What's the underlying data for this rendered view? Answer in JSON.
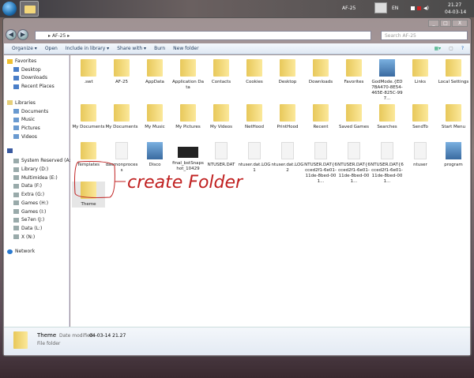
{
  "taskbar": {
    "user": "AF-25",
    "lang": "EN",
    "time": "21.27",
    "date": "04-03-14"
  },
  "window": {
    "caption_buttons": [
      "_",
      "□",
      "X"
    ]
  },
  "address": {
    "path": "AF-25",
    "separator": "▸",
    "search_placeholder": "Search AF-25"
  },
  "toolbar": {
    "items": [
      "Organize ▾",
      "Open",
      "Include in library ▾",
      "Share with ▾",
      "Burn",
      "New folder"
    ]
  },
  "sidebar": {
    "favorites": {
      "label": "Favorites",
      "items": [
        "Desktop",
        "Downloads",
        "Recent Places"
      ]
    },
    "libraries": {
      "label": "Libraries",
      "items": [
        "Documents",
        "Music",
        "Pictures",
        "Videos"
      ]
    },
    "computer": {
      "items": [
        "System Reserved (A:",
        "Library (D:)",
        "Multimidea (E:)",
        "Data (F:)",
        "Extra (G:)",
        "Games (H:)",
        "Games (I:)",
        "Se7en (J:)",
        "Data (L:)",
        "X (N:)"
      ]
    },
    "network": "Network"
  },
  "files": [
    {
      "name": ".swt",
      "type": "folder"
    },
    {
      "name": "AF-25",
      "type": "folder"
    },
    {
      "name": "AppData",
      "type": "folder"
    },
    {
      "name": "Application Data",
      "type": "folder"
    },
    {
      "name": "Contacts",
      "type": "folder"
    },
    {
      "name": "Cookies",
      "type": "folder"
    },
    {
      "name": "Desktop",
      "type": "folder"
    },
    {
      "name": "Downloads",
      "type": "folder"
    },
    {
      "name": "Favorites",
      "type": "folder"
    },
    {
      "name": "GodMode.{ED7BA470-8E54-465E-825C-997...",
      "type": "app"
    },
    {
      "name": "Links",
      "type": "folder"
    },
    {
      "name": "Local Settings",
      "type": "folder"
    },
    {
      "name": "My Documents",
      "type": "folder"
    },
    {
      "name": "My Documents",
      "type": "folder"
    },
    {
      "name": "My Music",
      "type": "folder"
    },
    {
      "name": "My Pictures",
      "type": "folder"
    },
    {
      "name": "My Videos",
      "type": "folder"
    },
    {
      "name": "NetHood",
      "type": "folder"
    },
    {
      "name": "PrintHood",
      "type": "folder"
    },
    {
      "name": "Recent",
      "type": "folder"
    },
    {
      "name": "Saved Games",
      "type": "folder"
    },
    {
      "name": "Searches",
      "type": "folder"
    },
    {
      "name": "SendTo",
      "type": "folder"
    },
    {
      "name": "Start Menu",
      "type": "folder"
    },
    {
      "name": "Templates",
      "type": "folder"
    },
    {
      "name": "daemonprocess",
      "type": "file"
    },
    {
      "name": "Disco",
      "type": "app"
    },
    {
      "name": "final_bstSnapshot_10429",
      "type": "image"
    },
    {
      "name": "NTUSER.DAT",
      "type": "file"
    },
    {
      "name": "ntuser.dat.LOG1",
      "type": "file"
    },
    {
      "name": "ntuser.dat.LOG2",
      "type": "file"
    },
    {
      "name": "NTUSER.DAT{6cced2f1-6e01-11de-8bed-001...",
      "type": "file"
    },
    {
      "name": "NTUSER.DAT{6cced2f1-6e01-11de-8bed-001...",
      "type": "file"
    },
    {
      "name": "NTUSER.DAT{6cced2f1-6e01-11de-8bed-001...",
      "type": "file"
    },
    {
      "name": "ntuser",
      "type": "file"
    },
    {
      "name": "program",
      "type": "app"
    },
    {
      "name": "Theme",
      "type": "folder"
    }
  ],
  "annotation": "create Folder",
  "details": {
    "name": "Theme",
    "date_label": "Date modified:",
    "date": "04-03-14 21.27",
    "type": "File folder"
  }
}
